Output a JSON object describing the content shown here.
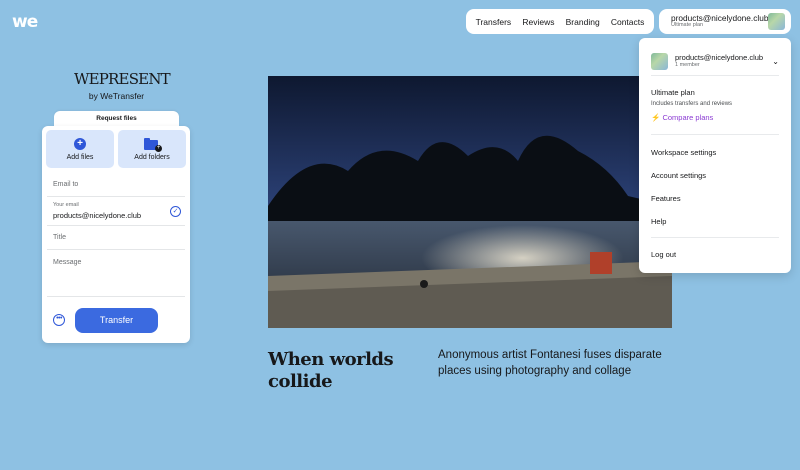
{
  "brand": {
    "logo": "we"
  },
  "nav": {
    "items": [
      "Transfers",
      "Reviews",
      "Branding",
      "Contacts"
    ]
  },
  "account": {
    "email": "products@nicelydone.club",
    "plan": "Ultimate plan"
  },
  "wepresent": {
    "title": "WEPRESENT",
    "by": "by WeTransfer"
  },
  "upload_panel": {
    "tab_label": "Request files",
    "add_files": "Add files",
    "add_folders": "Add folders",
    "email_to_placeholder": "Email to",
    "your_email_label": "Your email",
    "your_email_value": "products@nicelydone.club",
    "title_placeholder": "Title",
    "message_placeholder": "Message",
    "transfer_button": "Transfer"
  },
  "article": {
    "headline": "When worlds collide",
    "description": "Anonymous artist Fontanesi fuses disparate places using photography and collage"
  },
  "dropdown": {
    "account_email": "products@nicelydone.club",
    "members": "1 member",
    "plan_title": "Ultimate plan",
    "plan_desc": "Includes transfers and reviews",
    "compare": "Compare plans",
    "items": [
      "Workspace settings",
      "Account settings",
      "Features",
      "Help"
    ],
    "logout": "Log out"
  },
  "colors": {
    "background": "#8ec1e3",
    "accent": "#3b6ae0",
    "compare": "#8b3bd3"
  },
  "icons": [
    "plus-circle-icon",
    "add-folder-icon",
    "check-circle-icon",
    "more-icon",
    "chevron-down-icon",
    "lightning-icon"
  ]
}
